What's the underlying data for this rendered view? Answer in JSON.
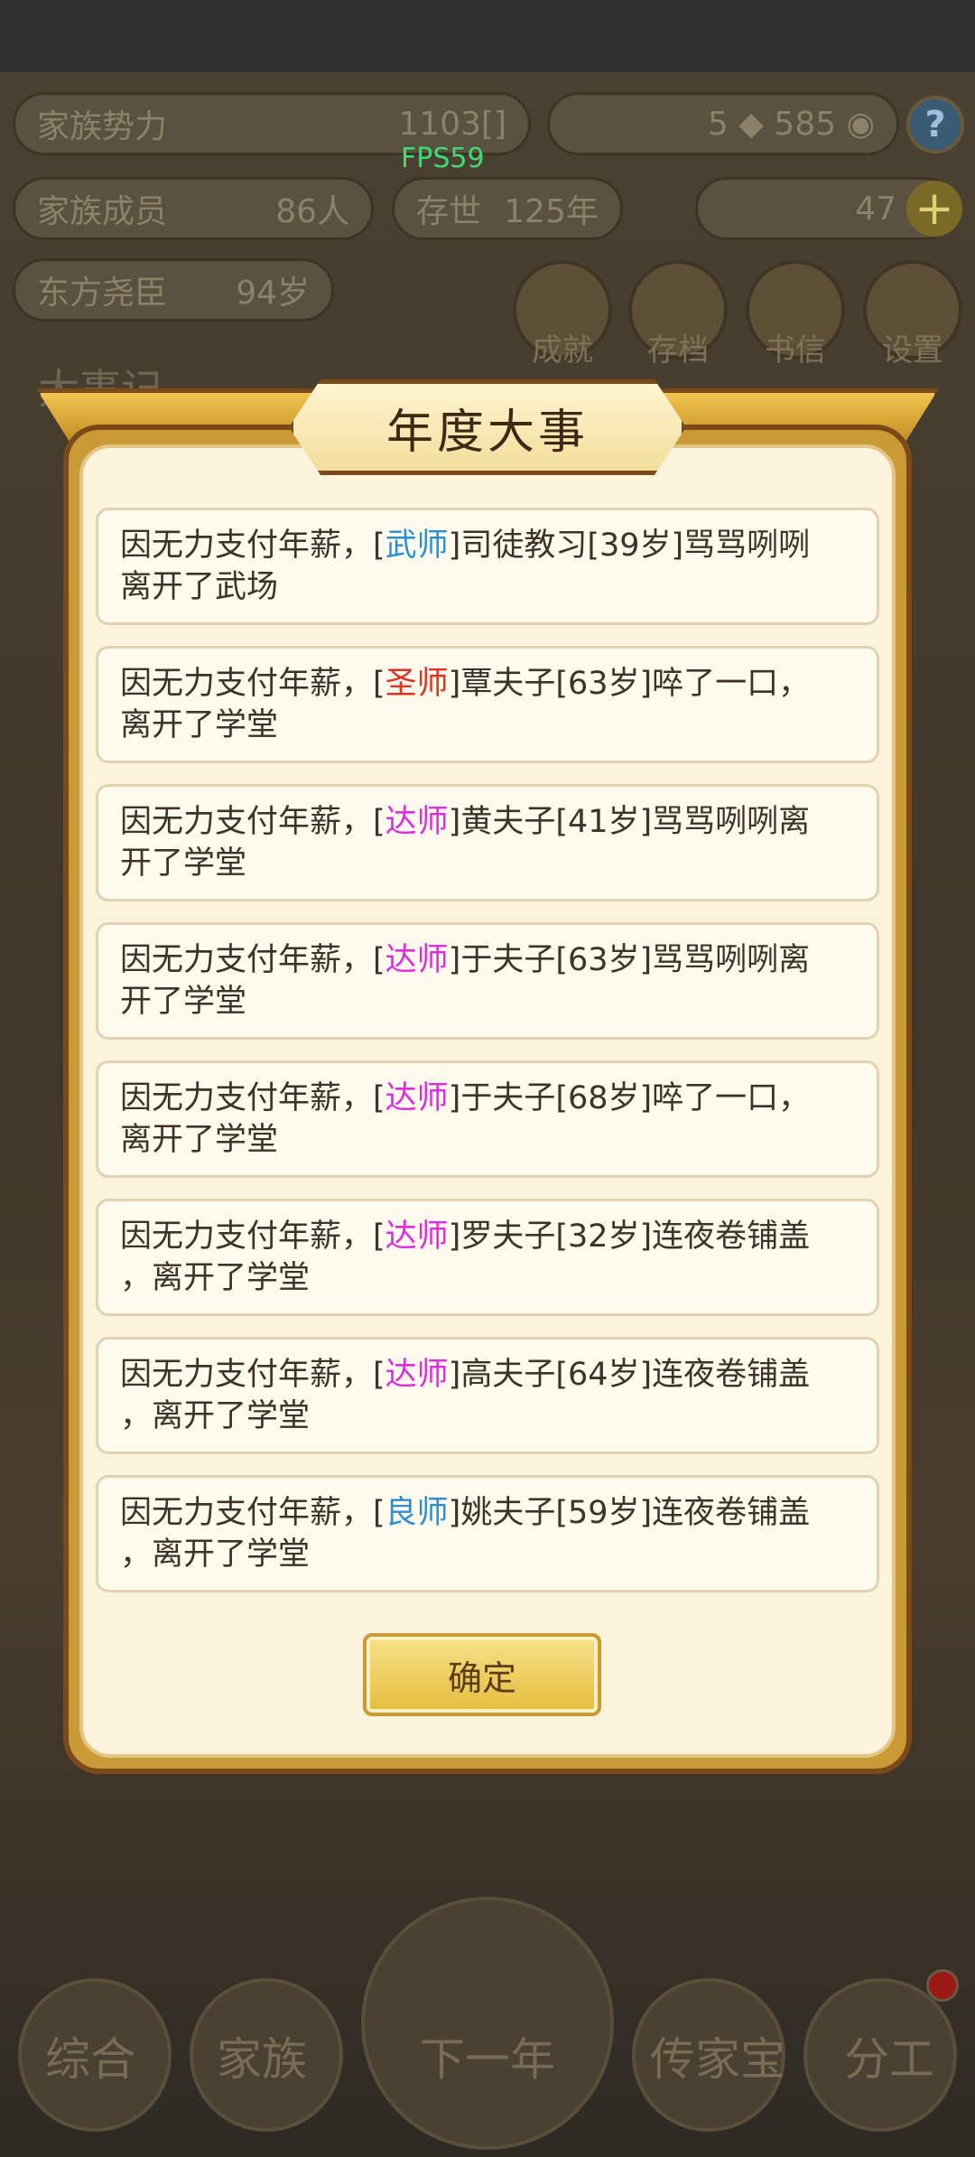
{
  "background": {
    "stats": {
      "power_label": "家族势力",
      "power_value": "1103[",
      "power_rank": "]",
      "currency_value": "5",
      "coin_value": "585",
      "members_label": "家族成员",
      "members_value": "86人",
      "era_label": "存世",
      "era_value": "125年",
      "ingot_value": "47",
      "patriarch_name": "东方尧臣",
      "patriarch_age": "94岁"
    },
    "fps": "FPS59",
    "menu": [
      "成就",
      "存档",
      "书信",
      "设置"
    ],
    "section_title": "大事记",
    "bottom_nav": [
      "综合",
      "家族",
      "下一年",
      "传家宝",
      "分工"
    ]
  },
  "modal": {
    "title": "年度大事",
    "events": [
      {
        "prefix": "因无力支付年薪，[",
        "role": "武师",
        "role_color": "#2f8ed1",
        "suffix": "]司徒教习[39岁]骂骂咧咧",
        "line2": "离开了武场"
      },
      {
        "prefix": "因无力支付年薪，[",
        "role": "圣师",
        "role_color": "#e1321f",
        "suffix": "]覃夫子[63岁]啐了一口，",
        "line2": "离开了学堂"
      },
      {
        "prefix": "因无力支付年薪，[",
        "role": "达师",
        "role_color": "#e02be0",
        "suffix": "]黄夫子[41岁]骂骂咧咧离",
        "line2": "开了学堂"
      },
      {
        "prefix": "因无力支付年薪，[",
        "role": "达师",
        "role_color": "#e02be0",
        "suffix": "]于夫子[63岁]骂骂咧咧离",
        "line2": "开了学堂"
      },
      {
        "prefix": "因无力支付年薪，[",
        "role": "达师",
        "role_color": "#e02be0",
        "suffix": "]于夫子[68岁]啐了一口，",
        "line2": "离开了学堂"
      },
      {
        "prefix": "因无力支付年薪，[",
        "role": "达师",
        "role_color": "#e02be0",
        "suffix": "]罗夫子[32岁]连夜卷铺盖",
        "line2": "，离开了学堂"
      },
      {
        "prefix": "因无力支付年薪，[",
        "role": "达师",
        "role_color": "#e02be0",
        "suffix": "]高夫子[64岁]连夜卷铺盖",
        "line2": "，离开了学堂"
      },
      {
        "prefix": "因无力支付年薪，[",
        "role": "良师",
        "role_color": "#2f8ed1",
        "suffix": "]姚夫子[59岁]连夜卷铺盖",
        "line2": "，离开了学堂"
      }
    ],
    "confirm_label": "确定"
  }
}
